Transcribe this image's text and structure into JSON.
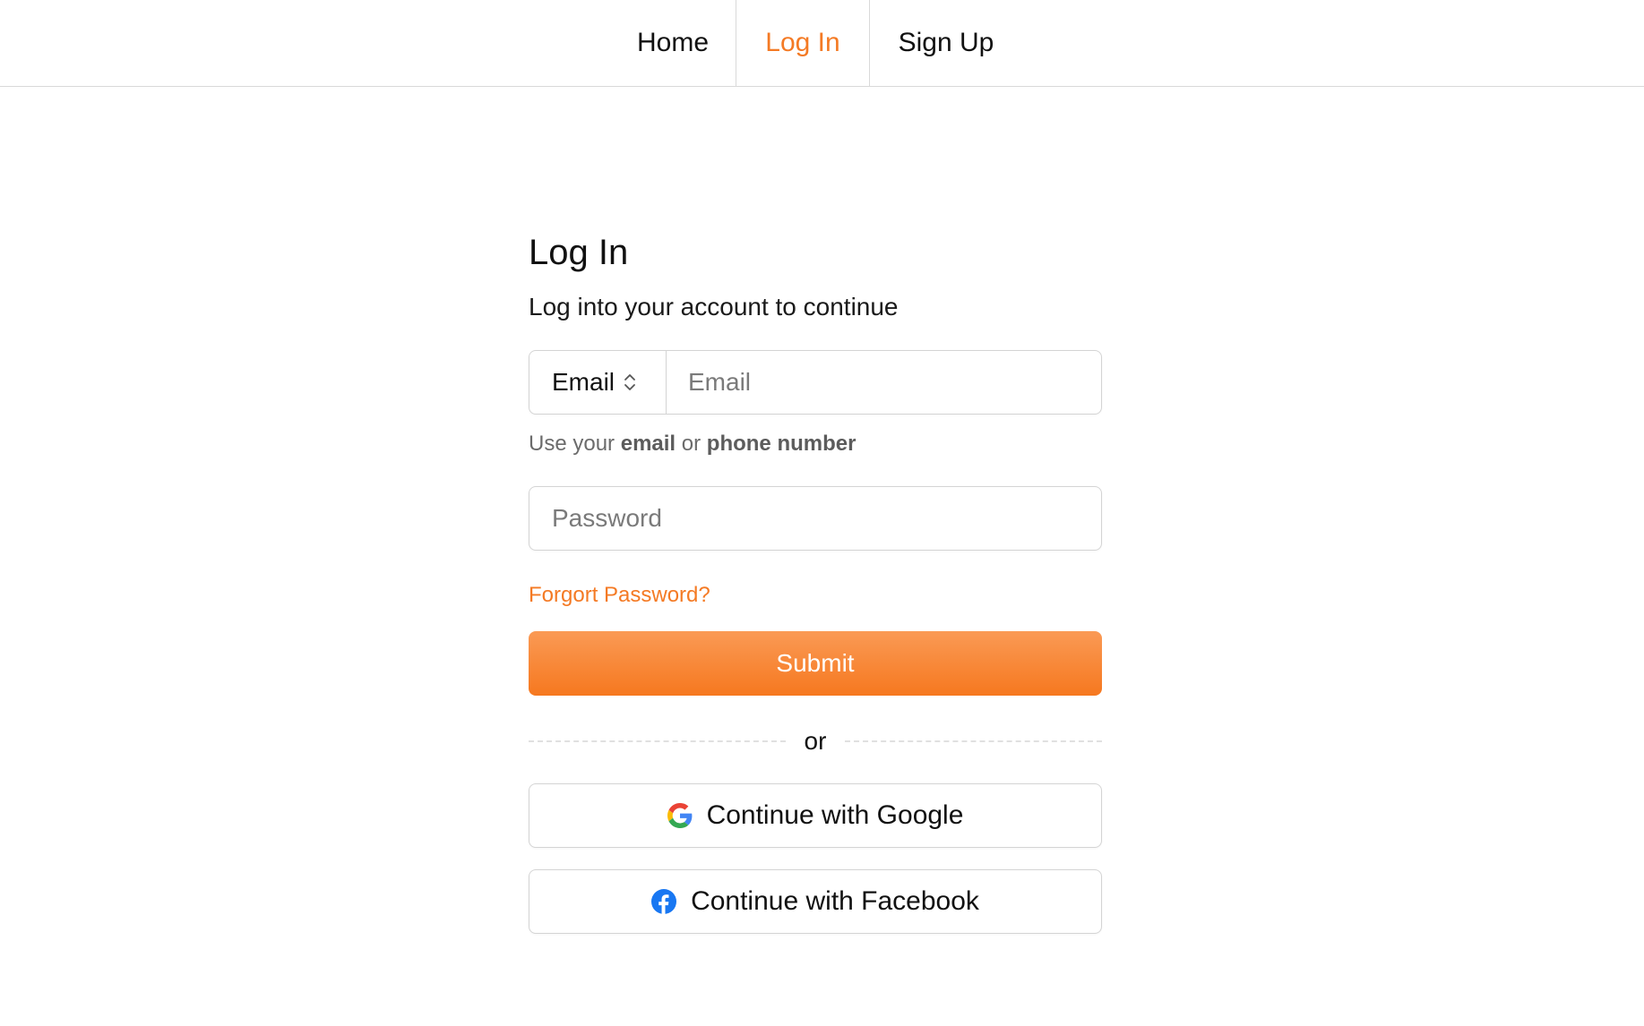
{
  "nav": {
    "items": [
      {
        "label": "Home"
      },
      {
        "label": "Log In",
        "active": true
      },
      {
        "label": "Sign Up"
      }
    ]
  },
  "form": {
    "title": "Log In",
    "subtitle": "Log into your account to continue",
    "identifier_type": "Email",
    "identifier_placeholder": "Email",
    "hint": {
      "prefix": "Use your",
      "opt1": "email",
      "mid": "or",
      "opt2": "phone number"
    },
    "password_placeholder": "Password",
    "forgot_label": "Forgort Password?",
    "submit_label": "Submit",
    "divider_label": "or",
    "google_label": "Continue with Google",
    "facebook_label": "Continue with Facebook"
  },
  "colors": {
    "accent": "#f47a24",
    "facebook": "#1877f2"
  },
  "icons": [
    "chevron-up-down-icon",
    "google-icon",
    "facebook-icon"
  ]
}
